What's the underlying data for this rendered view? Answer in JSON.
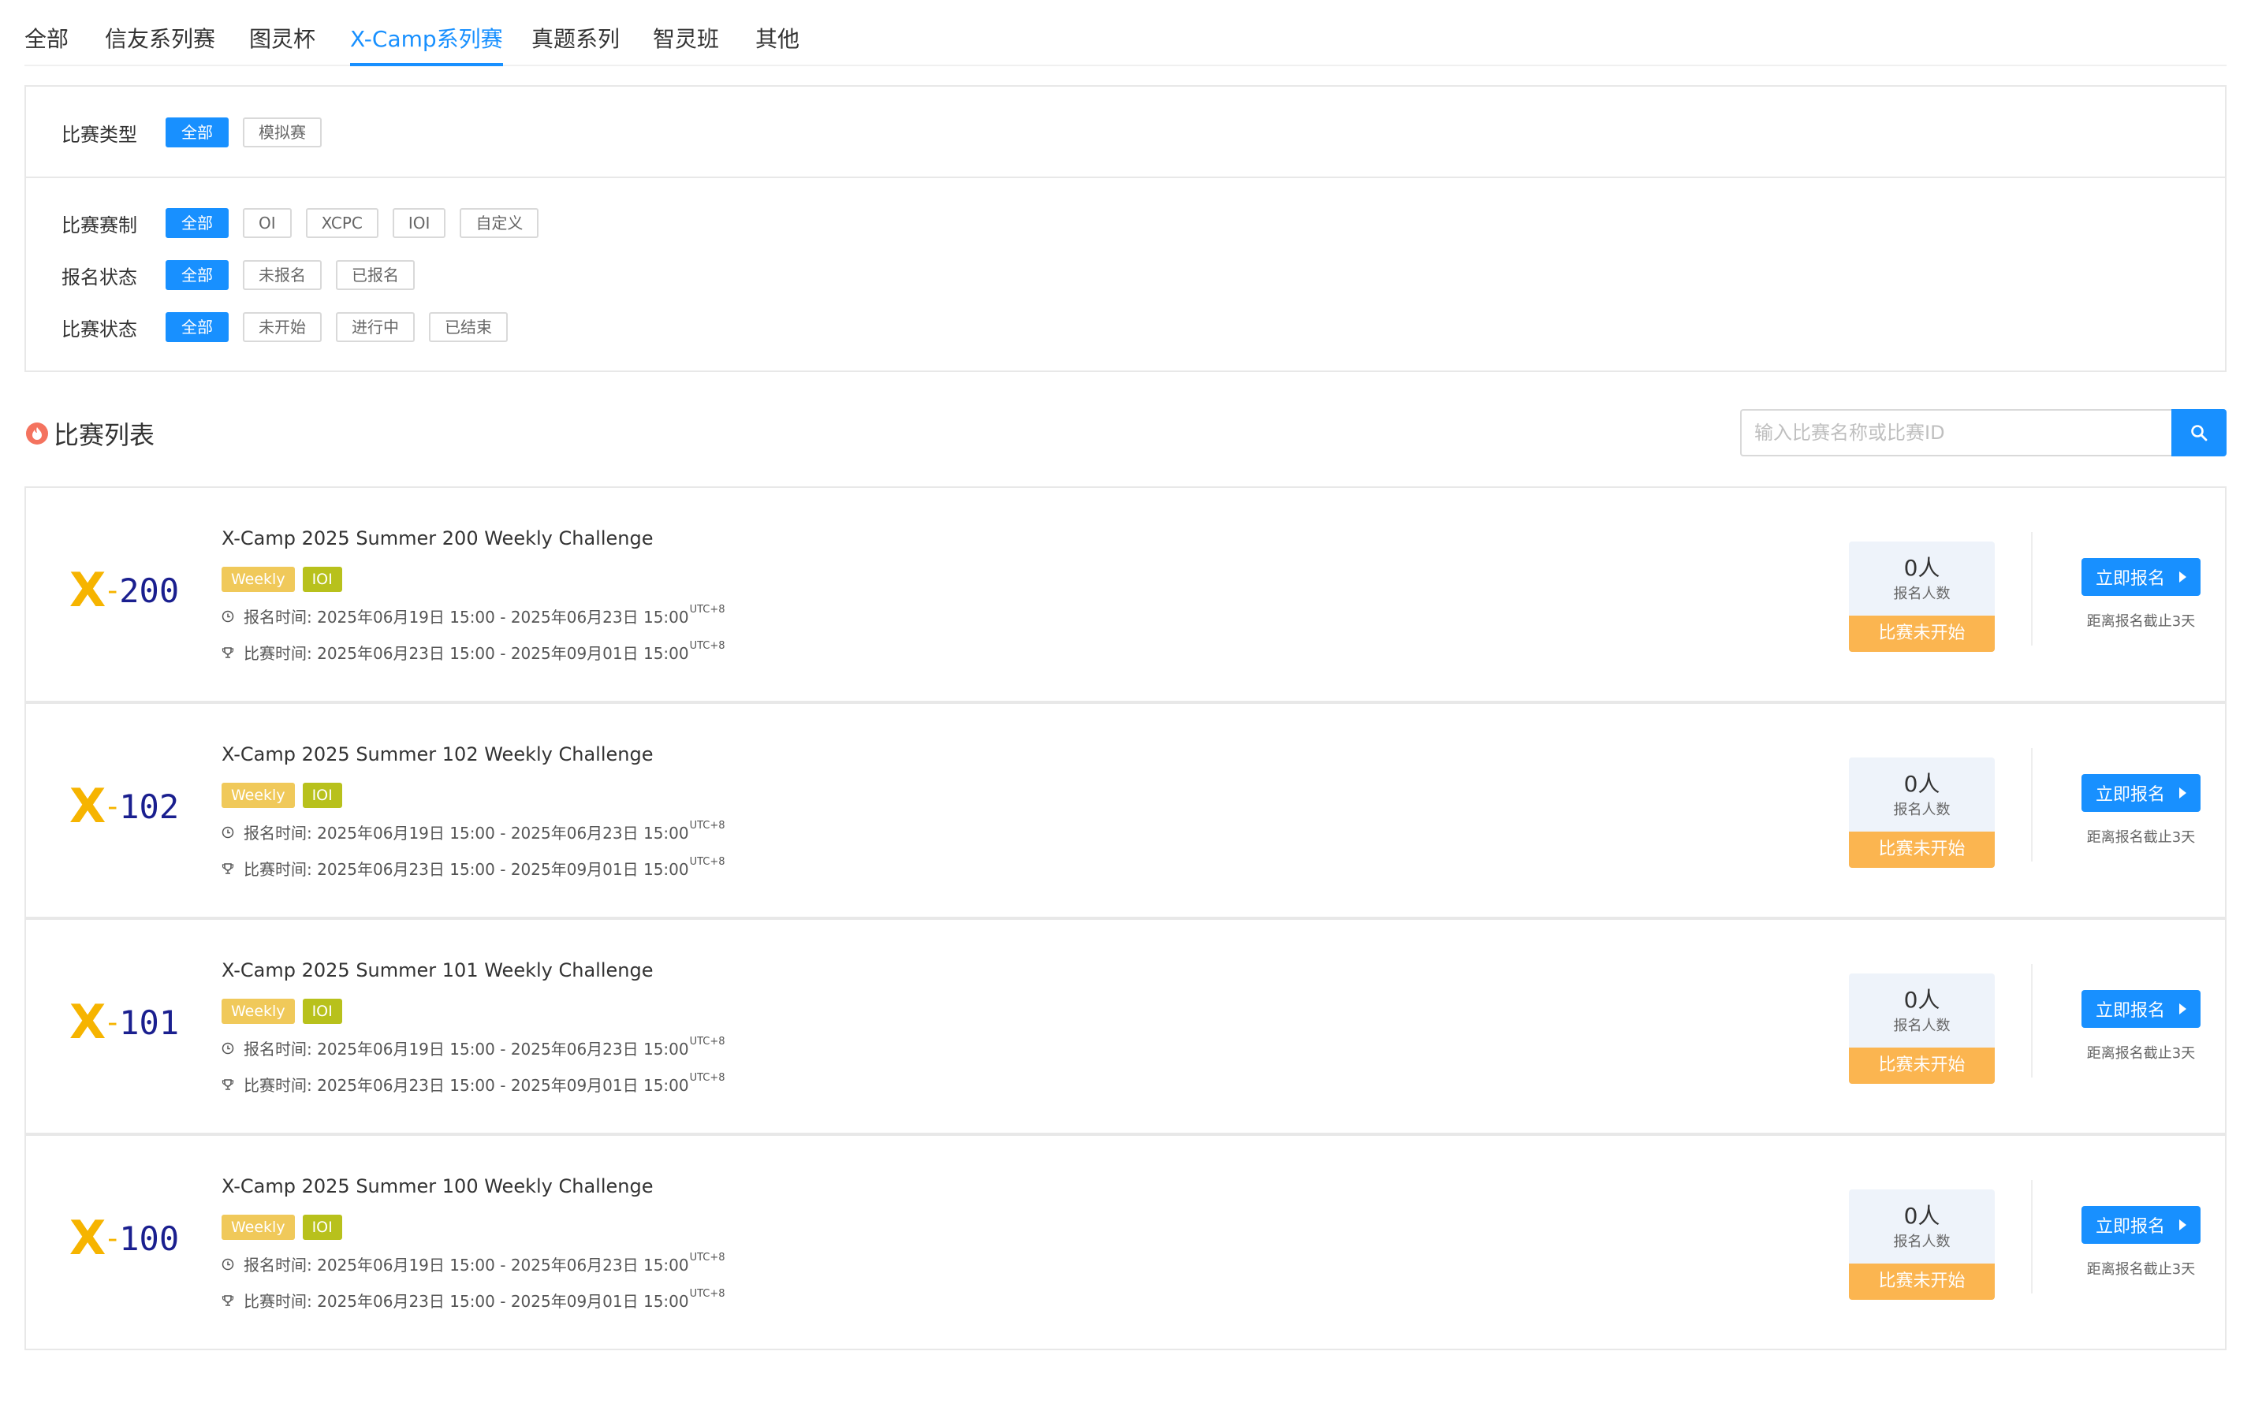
{
  "tabs": [
    {
      "label": "全部"
    },
    {
      "label": "信友系列赛"
    },
    {
      "label": "图灵杯"
    },
    {
      "label": "X-Camp系列赛",
      "active": true
    },
    {
      "label": "真题系列"
    },
    {
      "label": "智灵班"
    },
    {
      "label": "其他"
    }
  ],
  "filters": {
    "type": {
      "label": "比赛类型",
      "options": [
        "全部",
        "模拟赛"
      ]
    },
    "format": {
      "label": "比赛赛制",
      "options": [
        "全部",
        "OI",
        "XCPC",
        "IOI",
        "自定义"
      ]
    },
    "signup": {
      "label": "报名状态",
      "options": [
        "全部",
        "未报名",
        "已报名"
      ]
    },
    "status": {
      "label": "比赛状态",
      "options": [
        "全部",
        "未开始",
        "进行中",
        "已结束"
      ]
    }
  },
  "list": {
    "title": "比赛列表",
    "search_placeholder": "输入比赛名称或比赛ID"
  },
  "contests": [
    {
      "logo_x": "X",
      "logo_dash": "-",
      "logo_num": "200",
      "title": "X-Camp 2025 Summer 200 Weekly Challenge",
      "tag1": "Weekly",
      "tag2": "IOI",
      "signup_time": "报名时间: 2025年06月19日 15:00 - 2025年06月23日 15:00",
      "contest_time": "比赛时间: 2025年06月23日 15:00 - 2025年09月01日 15:00",
      "tz": "UTC+8",
      "count": "0人",
      "count_label": "报名人数",
      "status": "比赛未开始",
      "button": "立即报名",
      "deadline": "距离报名截止3天"
    },
    {
      "logo_x": "X",
      "logo_dash": "-",
      "logo_num": "102",
      "title": "X-Camp 2025 Summer 102 Weekly Challenge",
      "tag1": "Weekly",
      "tag2": "IOI",
      "signup_time": "报名时间: 2025年06月19日 15:00 - 2025年06月23日 15:00",
      "contest_time": "比赛时间: 2025年06月23日 15:00 - 2025年09月01日 15:00",
      "tz": "UTC+8",
      "count": "0人",
      "count_label": "报名人数",
      "status": "比赛未开始",
      "button": "立即报名",
      "deadline": "距离报名截止3天"
    },
    {
      "logo_x": "X",
      "logo_dash": "-",
      "logo_num": "101",
      "title": "X-Camp 2025 Summer 101 Weekly Challenge",
      "tag1": "Weekly",
      "tag2": "IOI",
      "signup_time": "报名时间: 2025年06月19日 15:00 - 2025年06月23日 15:00",
      "contest_time": "比赛时间: 2025年06月23日 15:00 - 2025年09月01日 15:00",
      "tz": "UTC+8",
      "count": "0人",
      "count_label": "报名人数",
      "status": "比赛未开始",
      "button": "立即报名",
      "deadline": "距离报名截止3天"
    },
    {
      "logo_x": "X",
      "logo_dash": "-",
      "logo_num": "100",
      "title": "X-Camp 2025 Summer 100 Weekly Challenge",
      "tag1": "Weekly",
      "tag2": "IOI",
      "signup_time": "报名时间: 2025年06月19日 15:00 - 2025年06月23日 15:00",
      "contest_time": "比赛时间: 2025年06月23日 15:00 - 2025年09月01日 15:00",
      "tz": "UTC+8",
      "count": "0人",
      "count_label": "报名人数",
      "status": "比赛未开始",
      "button": "立即报名",
      "deadline": "距离报名截止3天"
    }
  ],
  "colors": {
    "accent": "#1890ff",
    "weekly_tag": "#f0c95a",
    "ioi_tag": "#b8c11c",
    "not_started": "#fbb550"
  }
}
